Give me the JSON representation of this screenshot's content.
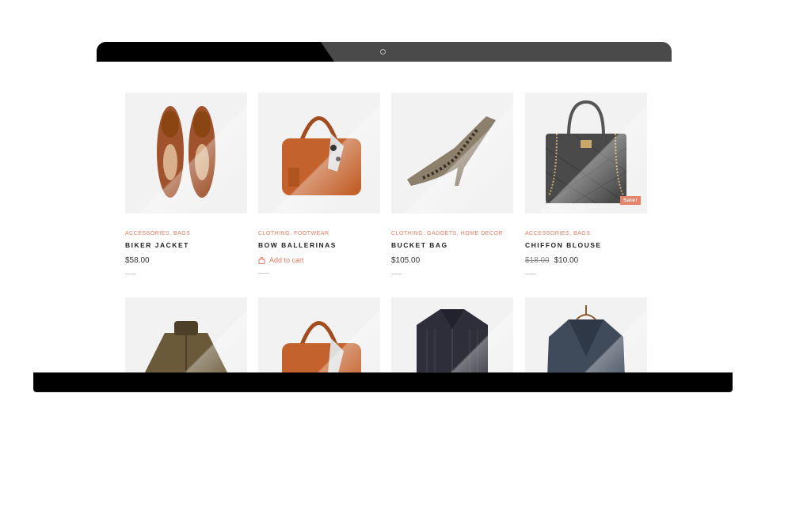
{
  "products": [
    {
      "categories": "Accessories, Bags",
      "name": "Biker Jacket",
      "price": "$58.00",
      "old_price": "",
      "action": ""
    },
    {
      "categories": "Clothing, Footwear",
      "name": "Bow Ballerinas",
      "price": "",
      "old_price": "",
      "action": "Add to cart"
    },
    {
      "categories": "Clothing, Gadgets, Home Decor",
      "name": "Bucket Bag",
      "price": "$105.00",
      "old_price": "",
      "action": ""
    },
    {
      "categories": "Accessories, Bags",
      "name": "Chiffon Blouse",
      "price": "$10.00",
      "old_price": "$18.00",
      "action": "",
      "badge": "Sale!"
    }
  ],
  "colors": {
    "accent": "#e07a5f",
    "badge": "#e8836b",
    "tile": "#f2f2f2"
  },
  "icons": {
    "cart": "bag-icon",
    "camera": "webcam-icon"
  }
}
